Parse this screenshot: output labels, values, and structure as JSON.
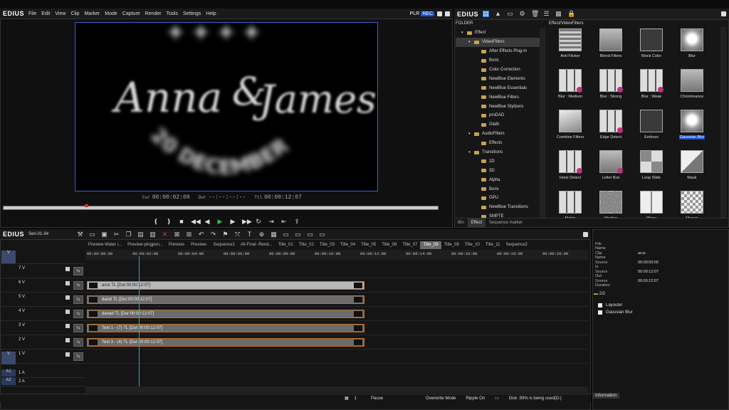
{
  "app": {
    "name": "EDIUS"
  },
  "menu": [
    "File",
    "Edit",
    "View",
    "Clip",
    "Marker",
    "Mode",
    "Capture",
    "Render",
    "Tools",
    "Settings",
    "Help"
  ],
  "player": {
    "plr": "PLR",
    "rec": "REC",
    "preview_text": {
      "line1": "Anna",
      "amp": "&",
      "line2": "James",
      "arc": "20 DECEMBER"
    },
    "cur_label": "Cur",
    "cur": "00:00:02:08",
    "dur_label": "Dur",
    "dur": "--:--:--:--",
    "ttl_label": "Ttl",
    "ttl": "00:00:12:07"
  },
  "effects": {
    "logo": "EDIUS",
    "folder_header": "FOLDER",
    "path": "Effect/VideoFilters",
    "tree": [
      {
        "label": "Effect",
        "level": 0
      },
      {
        "label": "VideoFilters",
        "level": 1,
        "selected": true
      },
      {
        "label": "After Effects Plug-in",
        "level": 2
      },
      {
        "label": "Boris",
        "level": 2
      },
      {
        "label": "Color Correction",
        "level": 2
      },
      {
        "label": "NewBlue Elements",
        "level": 2
      },
      {
        "label": "NewBlue Essentials",
        "level": 2
      },
      {
        "label": "NewBlue Filters",
        "level": 2
      },
      {
        "label": "NewBlue Stylizers",
        "level": 2
      },
      {
        "label": "proDAD",
        "level": 2
      },
      {
        "label": "Glath",
        "level": 2
      },
      {
        "label": "AudioFilters",
        "level": 1
      },
      {
        "label": "Effects",
        "level": 2
      },
      {
        "label": "Transitions",
        "level": 1
      },
      {
        "label": "2D",
        "level": 2
      },
      {
        "label": "3D",
        "level": 2
      },
      {
        "label": "Alpha",
        "level": 2
      },
      {
        "label": "Boris",
        "level": 2
      },
      {
        "label": "GPU",
        "level": 2
      },
      {
        "label": "NewBlue Transitions",
        "level": 2
      },
      {
        "label": "SMPTE",
        "level": 2
      }
    ],
    "items": [
      {
        "label": "Anti Flicker",
        "style": "stripes"
      },
      {
        "label": "Blend Filters",
        "style": "gray"
      },
      {
        "label": "Block Color",
        "style": "dark"
      },
      {
        "label": "Blur",
        "style": "blur"
      },
      {
        "label": "Blur : Medium",
        "style": "grid",
        "dot": true
      },
      {
        "label": "Blur : Strong",
        "style": "grid",
        "dot": true
      },
      {
        "label": "Blur : Weak",
        "style": "grid",
        "dot": true
      },
      {
        "label": "Chrominance",
        "style": "gray"
      },
      {
        "label": "Combine Filters",
        "style": "layers"
      },
      {
        "label": "Edge Detect",
        "style": "grid",
        "dot": true
      },
      {
        "label": "Emboss",
        "style": "dark"
      },
      {
        "label": "Gaussian Blur",
        "style": "blur",
        "highlight": true
      },
      {
        "label": "Horiz Detect",
        "style": "grid",
        "dot": true
      },
      {
        "label": "Letter Box",
        "style": "gray",
        "dot": true
      },
      {
        "label": "Loop Slide",
        "style": "quad"
      },
      {
        "label": "Mask",
        "style": "mask"
      },
      {
        "label": "Matrix",
        "style": "grid"
      },
      {
        "label": "Median",
        "style": "noise"
      },
      {
        "label": "Mirror",
        "style": "mirror"
      },
      {
        "label": "Mosaic",
        "style": "mosaic"
      }
    ],
    "tabs": [
      "Bin",
      "Effect",
      "Sequence marker"
    ]
  },
  "timeline": {
    "logo": "EDIUS",
    "project": "Seri-01-34",
    "sequence_tabs": [
      "Preview-Water i...",
      "Preview-pingpon...",
      "Preview-",
      "Preview-",
      "Sequence1",
      "All-Final -Rend...",
      "Title_01",
      "Title_02",
      "Title_03",
      "Title_04",
      "Title_05",
      "Title_06",
      "Title_07",
      "Title_08",
      "Title_09",
      "Title_10",
      "Title_11",
      "Sequence2"
    ],
    "active_tab": "Title_08",
    "ruler": [
      "00:00:00:00",
      "00:00:02:00",
      "00:00:04:00",
      "00:00:06:00",
      "00:00:08:00",
      "00:00:10:00",
      "00:00:12:00",
      "00:00:14:00",
      "00:00:16:00",
      "00:00:18:00",
      "00:00:20:00"
    ],
    "tracks": [
      "7 V",
      "6 V",
      "5 V",
      "4 V",
      "3 V",
      "2 V",
      "1 V"
    ],
    "audio_tracks": [
      "1 A",
      "2 A"
    ],
    "audio_patches": [
      "A1",
      "A2"
    ],
    "patch_v": "V",
    "patch_a": "A",
    "clips": [
      {
        "track": 1,
        "label": "arus  TL [Dur:00:00:12:07]",
        "white": true
      },
      {
        "track": 2,
        "label": "&and  TL [Dur:00:00:12:07]"
      },
      {
        "track": 3,
        "label": "danad  TL [Dur:00:00:12:07]"
      },
      {
        "track": 4,
        "label": "Text 1 - (7)  TL [Dur:00:00:12:07]"
      },
      {
        "track": 5,
        "label": "Text 3 - (4)  TL [Dur:00:00:12:07]"
      }
    ]
  },
  "status": {
    "count": "1",
    "state": "Pause",
    "mode": "Overwrite Mode",
    "ripple": "Ripple On",
    "disk": "Disk :99% is being used(D:)"
  },
  "info": {
    "rows": [
      {
        "k": "File Name",
        "v": ""
      },
      {
        "k": "Clip Name",
        "v": "arus"
      },
      {
        "k": "Source In",
        "v": "00:00:00:00"
      },
      {
        "k": "Source Out",
        "v": "00:00:12:07"
      },
      {
        "k": "Source Duration",
        "v": "00:00:12:07"
      }
    ],
    "count": "2/2",
    "effects": [
      "Layouter",
      "Gaussian Blur"
    ],
    "tab": "Information"
  }
}
